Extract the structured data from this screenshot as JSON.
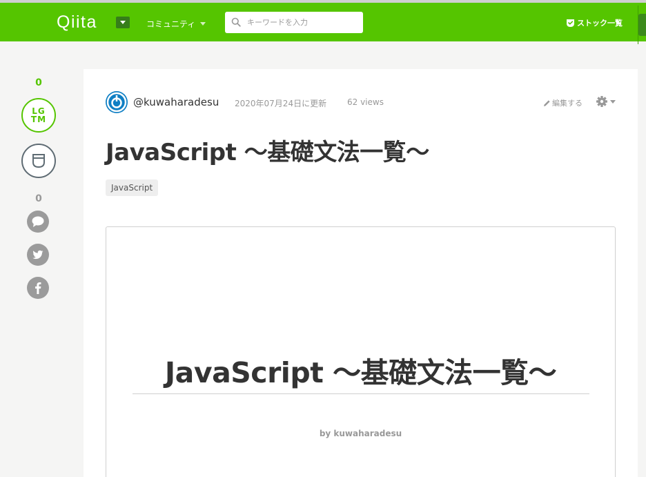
{
  "header": {
    "logo": "Qiita",
    "community_label": "コミュニティ",
    "search_placeholder": "キーワードを入力",
    "stock_list_label": "ストック一覧",
    "brand_color": "#55c500"
  },
  "sidebar": {
    "lgtm_count": "0",
    "lgtm_label_line1": "LG",
    "lgtm_label_line2": "TM",
    "comment_count": "0",
    "icons": [
      "stock-icon",
      "comment-icon",
      "twitter-icon",
      "facebook-icon"
    ]
  },
  "article": {
    "author": "@kuwaharadesu",
    "updated": "2020年07月24日に更新",
    "views": "62 views",
    "edit_label": "編集する",
    "title": "JavaScript 〜基礎文法一覧〜",
    "tags": [
      "JavaScript"
    ]
  },
  "slide": {
    "title": "JavaScript 〜基礎文法一覧〜",
    "byline": "by kuwaharadesu"
  }
}
